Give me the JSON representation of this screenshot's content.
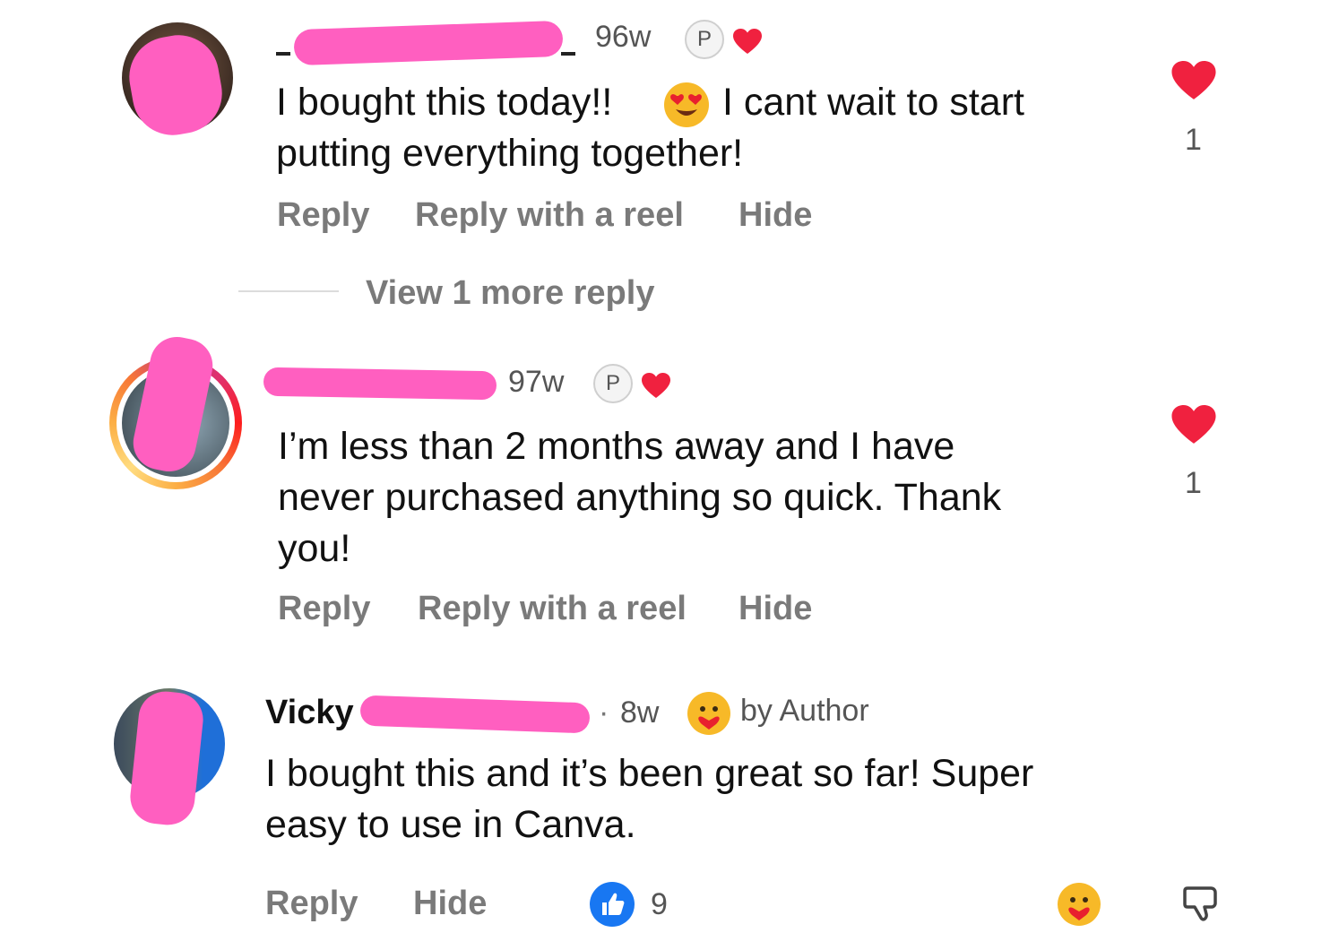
{
  "comments": [
    {
      "time": "96w",
      "badge": "P",
      "text_line1": "I bought this today!!",
      "text_line1b": "I cant wait to start",
      "text_line2": "putting everything together!",
      "actions": [
        "Reply",
        "Reply with a reel",
        "Hide"
      ],
      "like_count": "1",
      "view_more": "View 1 more reply"
    },
    {
      "time": "97w",
      "badge": "P",
      "text_lines": [
        "I’m less than 2 months away and I have",
        "never purchased anything so quick. Thank",
        "you!"
      ],
      "actions": [
        "Reply",
        "Reply with a reel",
        "Hide"
      ],
      "like_count": "1"
    },
    {
      "name_visible": "Vicky",
      "time": "8w",
      "author_tag": "by Author",
      "text_lines": [
        "I bought this and it’s been great so far! Super",
        "easy to use in Canva."
      ],
      "actions": [
        "Reply",
        "Hide"
      ],
      "reaction_count": "9"
    }
  ],
  "colors": {
    "heart": "#f0213f",
    "redaction": "#ff5fc0",
    "like_blue": "#1877f2"
  },
  "icons": [
    "heart-icon",
    "love-eyes-emoji-icon",
    "care-emoji-icon",
    "thumbs-up-icon",
    "thumbs-down-icon"
  ]
}
